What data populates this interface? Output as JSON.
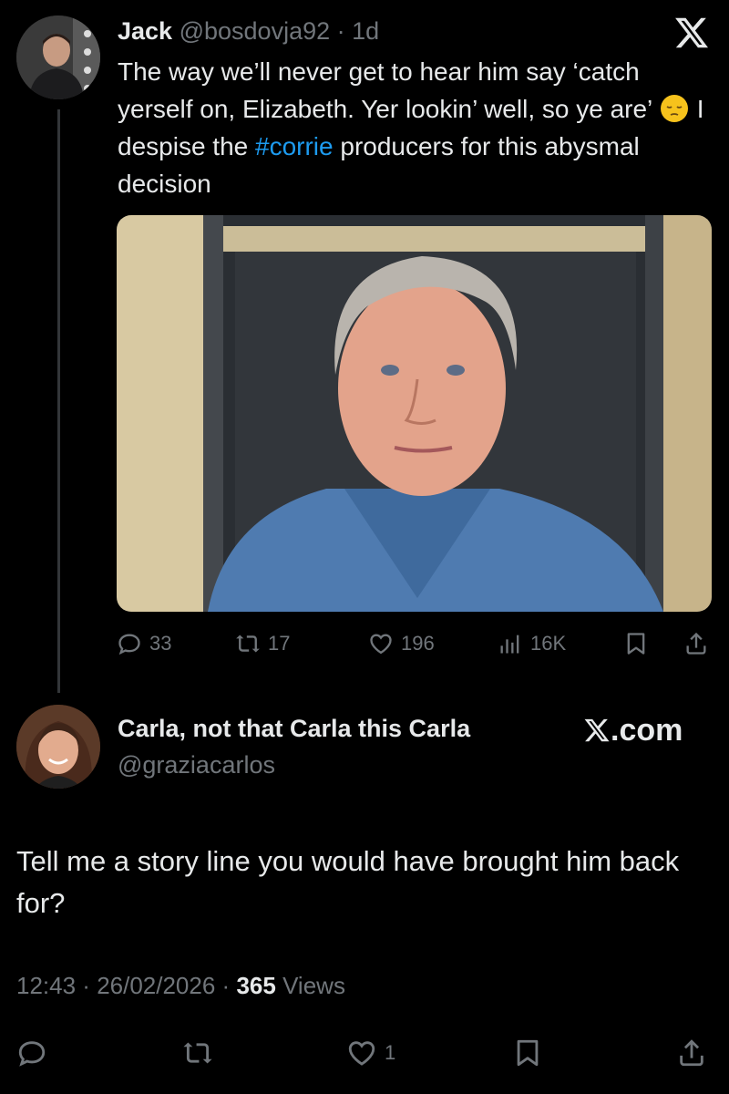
{
  "tweet": {
    "author_name": "Jack",
    "author_handle": "@bosdovja92",
    "time_ago": "1d",
    "text_before_emoji": "The way we’ll never get to hear him say ‘catch yerself on, Elizabeth. Yer lookin’ well, so ye are’ ",
    "emoji": "pensive-face-emoji",
    "text_after_emoji": " I despise the ",
    "hashtag": "#corrie",
    "text_end": " producers for this abysmal decision",
    "stats": {
      "replies": "33",
      "reposts": "17",
      "likes": "196",
      "views": "16K"
    }
  },
  "reply": {
    "author_name": "Carla, not that Carla this Carla",
    "author_handle": "@graziacarlos",
    "brand": ".com",
    "text": "Tell me a story line you would have brought him back for?",
    "time": "12:43",
    "date": "26/02/2026",
    "views_count": "365",
    "views_label": "Views",
    "likes": "1"
  },
  "colors": {
    "background": "#000000",
    "text": "#e7e9ea",
    "muted": "#71767b",
    "accent": "#1d9bf0"
  }
}
